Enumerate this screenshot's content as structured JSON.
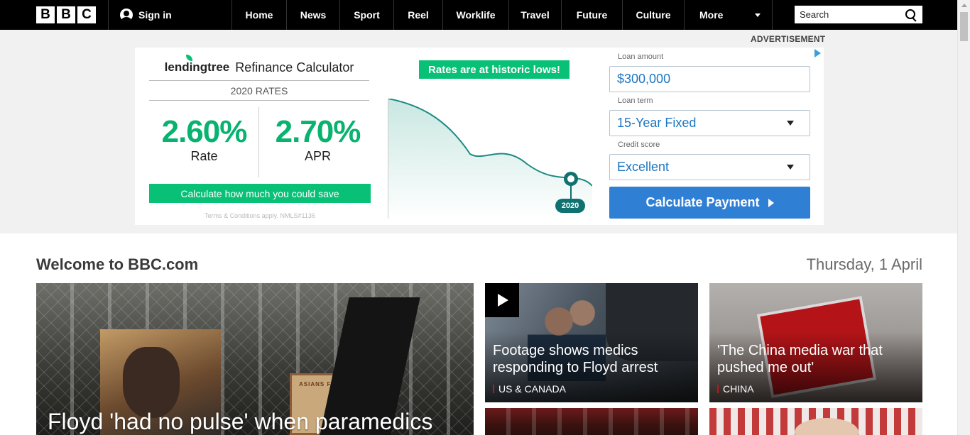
{
  "nav": {
    "logo_letters": [
      "B",
      "B",
      "C"
    ],
    "sign_in": "Sign in",
    "items": [
      "Home",
      "News",
      "Sport",
      "Reel",
      "Worklife",
      "Travel",
      "Future",
      "Culture"
    ],
    "more": "More",
    "search_placeholder": "Search"
  },
  "ad": {
    "label": "ADVERTISEMENT",
    "brand": "lendingtree",
    "title": "Refinance Calculator",
    "rates_label": "2020 RATES",
    "rate_value": "2.60%",
    "rate_caption": "Rate",
    "apr_value": "2.70%",
    "apr_caption": "APR",
    "cta": "Calculate how much you could save",
    "terms": "Terms & Conditions apply. NMLS#1136",
    "banner": "Rates are at historic lows!",
    "chart_year": "2020",
    "loan_amount_label": "Loan amount",
    "loan_amount_value": "$300,000",
    "loan_term_label": "Loan term",
    "loan_term_value": "15-Year Fixed",
    "credit_score_label": "Credit score",
    "credit_score_value": "Excellent",
    "calc_button": "Calculate Payment"
  },
  "main": {
    "welcome": "Welcome to BBC.com",
    "date": "Thursday, 1 April",
    "hero": {
      "title": "Floyd 'had no pulse' when paramedics",
      "sign_text": "ASIANS FOR"
    },
    "stories": [
      {
        "title": "Footage shows medics responding to Floyd arrest",
        "tag": "US & CANADA"
      },
      {
        "title": "'The China media war that pushed me out'",
        "tag": "CHINA"
      }
    ]
  },
  "colors": {
    "nav_bg": "#000000",
    "lendingtree_green": "#08c177",
    "calc_blue": "#2f7fd4",
    "tag_red": "#bb1919"
  }
}
